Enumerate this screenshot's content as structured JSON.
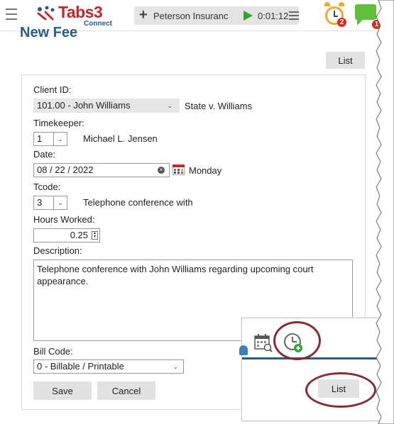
{
  "topbar": {
    "logo_name": "Tabs3",
    "logo_sub": "Connect",
    "timer_client": "Peterson Insuranc",
    "timer_time": "0:01:12",
    "alarm_badge": "2",
    "chat_badge": "1"
  },
  "page": {
    "title": "New Fee",
    "list_label": "List"
  },
  "form": {
    "client_id_label": "Client ID:",
    "client_id_value": "101.00 - John Williams",
    "client_case": "State v. Williams",
    "timekeeper_label": "Timekeeper:",
    "timekeeper_value": "1",
    "timekeeper_name": "Michael L. Jensen",
    "date_label": "Date:",
    "date_value": "08 / 22 / 2022",
    "date_day": "Monday",
    "tcode_label": "Tcode:",
    "tcode_value": "3",
    "tcode_desc": "Telephone conference with",
    "hours_label": "Hours Worked:",
    "hours_value": "0.25",
    "description_label": "Description:",
    "description_value": "Telephone conference with John Williams regarding upcoming court appearance.",
    "bill_code_label": "Bill Code:",
    "bill_code_value": "0 - Billable / Printable",
    "save_label": "Save",
    "cancel_label": "Cancel"
  },
  "callout": {
    "list_label": "List"
  },
  "colors": {
    "accent": "#2a5c8a",
    "logo_red": "#c0282d",
    "play_green": "#2aa830",
    "alarm_orange": "#f0a830",
    "chat_green": "#5fbf3a",
    "badge_red": "#d42c21",
    "highlight_oval": "#8a2a33"
  }
}
